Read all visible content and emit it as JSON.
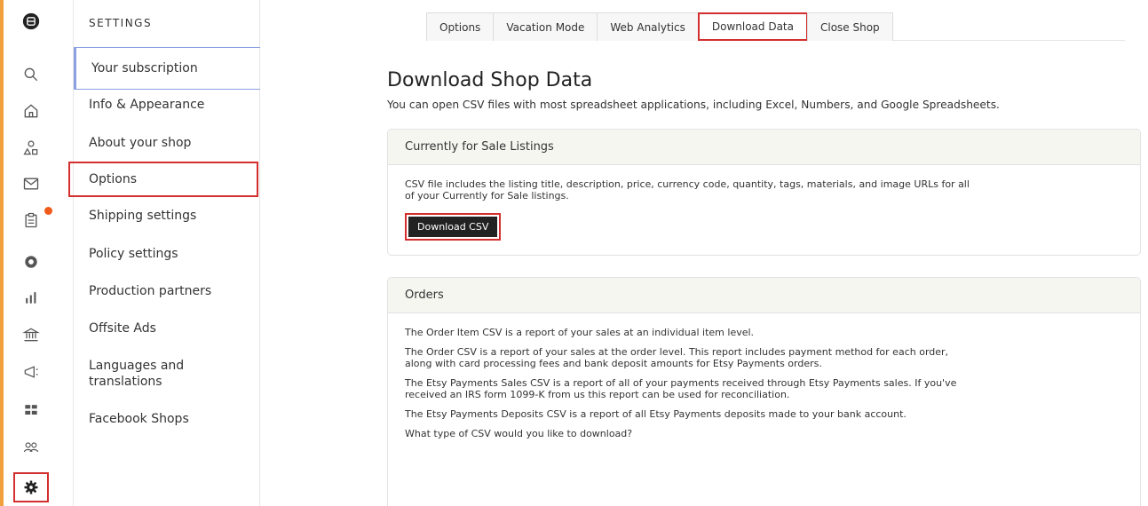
{
  "rail": {
    "icons": [
      "etsy-logo-icon",
      "search-icon",
      "home-icon",
      "shapes-icon",
      "mail-icon",
      "orders-icon",
      "star-icon",
      "stats-icon",
      "bank-icon",
      "megaphone-icon",
      "grid-icon",
      "community-icon",
      "gear-icon"
    ]
  },
  "settings": {
    "title": "SETTINGS",
    "items": [
      "Your subscription",
      "Info & Appearance",
      "About your shop",
      "Options",
      "Shipping settings",
      "Policy settings",
      "Production partners",
      "Offsite Ads",
      "Languages and translations",
      "Facebook Shops"
    ]
  },
  "tabs": [
    "Options",
    "Vacation Mode",
    "Web Analytics",
    "Download Data",
    "Close Shop"
  ],
  "page": {
    "title": "Download Shop Data",
    "subtitle": "You can open CSV files with most spreadsheet applications, including Excel, Numbers, and Google Spreadsheets."
  },
  "listings": {
    "header": "Currently for Sale Listings",
    "desc": "CSV file includes the listing title, description, price, currency code, quantity, tags, materials, and image URLs for all of your Currently for Sale listings.",
    "button": "Download CSV"
  },
  "orders": {
    "header": "Orders",
    "p1": "The Order Item CSV is a report of your sales at an individual item level.",
    "p2": "The Order CSV is a report of your sales at the order level. This report includes payment method for each order, along with card processing fees and bank deposit amounts for Etsy Payments orders.",
    "p3": "The Etsy Payments Sales CSV is a report of all of your payments received through Etsy Payments sales. If you've received an IRS form 1099-K from us this report can be used for reconciliation.",
    "p4": "The Etsy Payments Deposits CSV is a report of all Etsy Payments deposits made to your bank account.",
    "p5": "What type of CSV would you like to download?"
  },
  "colors": {
    "accent": "#f1a13b",
    "highlight": "#d32f2f",
    "button": "#222222"
  }
}
